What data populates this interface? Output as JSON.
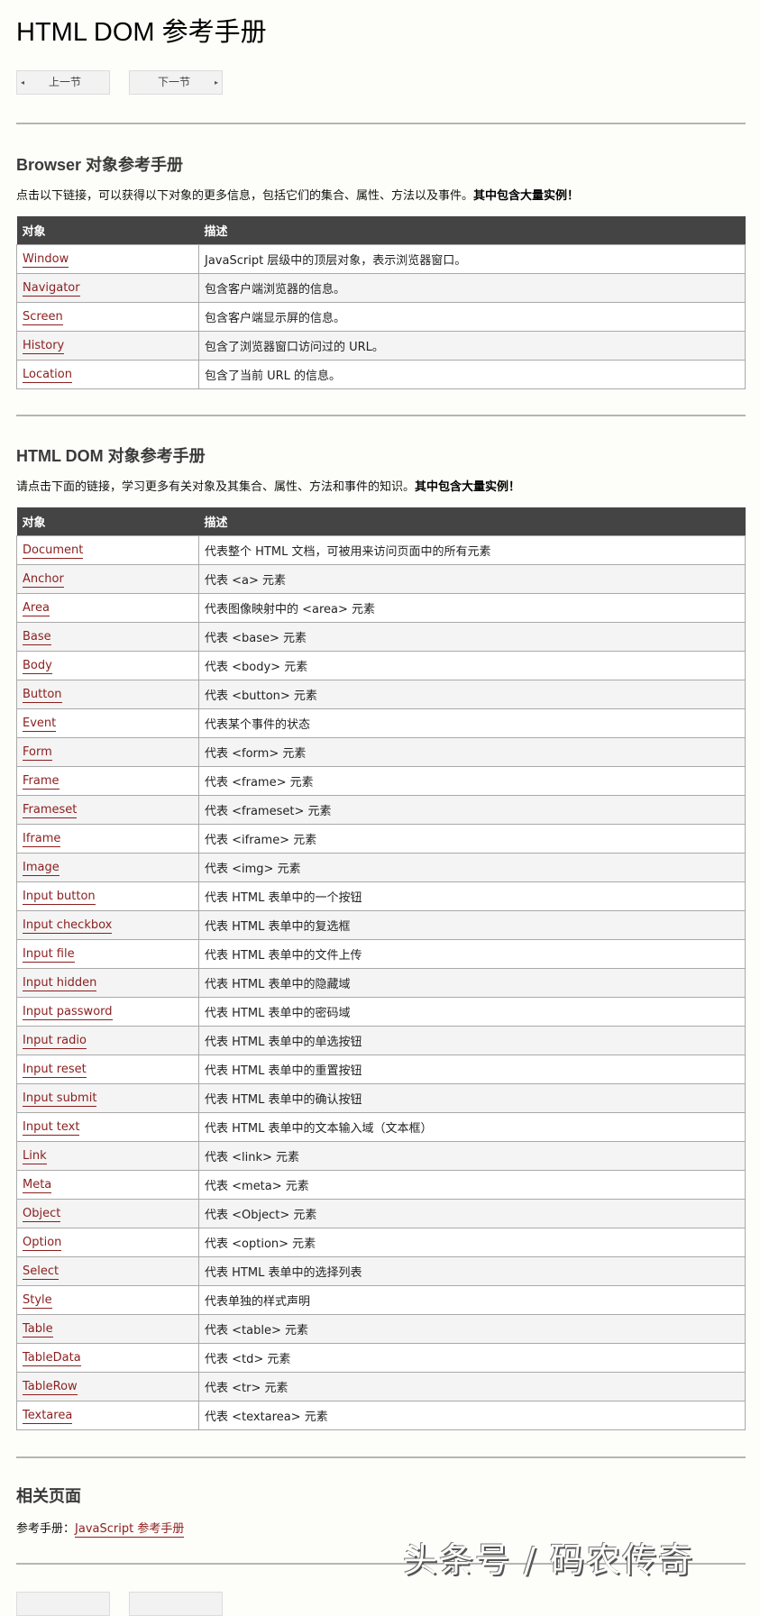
{
  "page_title": "HTML DOM 参考手册",
  "nav": {
    "prev_label": "上一节",
    "next_label": "下一节",
    "prev_icon": "◂",
    "next_icon": "▸"
  },
  "browser_section": {
    "heading": "Browser 对象参考手册",
    "intro": "点击以下链接，可以获得以下对象的更多信息，包括它们的集合、属性、方法以及事件。",
    "intro_bold": "其中包含大量实例！",
    "columns": [
      "对象",
      "描述"
    ],
    "rows": [
      {
        "name": "Window",
        "desc": "JavaScript 层级中的顶层对象，表示浏览器窗口。"
      },
      {
        "name": "Navigator",
        "desc": "包含客户端浏览器的信息。"
      },
      {
        "name": "Screen",
        "desc": "包含客户端显示屏的信息。"
      },
      {
        "name": "History",
        "desc": "包含了浏览器窗口访问过的 URL。"
      },
      {
        "name": "Location",
        "desc": "包含了当前 URL 的信息。"
      }
    ]
  },
  "dom_section": {
    "heading": "HTML DOM 对象参考手册",
    "intro": "请点击下面的链接，学习更多有关对象及其集合、属性、方法和事件的知识。",
    "intro_bold": "其中包含大量实例！",
    "columns": [
      "对象",
      "描述"
    ],
    "rows": [
      {
        "name": "Document",
        "desc": "代表整个 HTML 文档，可被用来访问页面中的所有元素"
      },
      {
        "name": "Anchor",
        "desc": "代表 <a> 元素"
      },
      {
        "name": "Area",
        "desc": "代表图像映射中的 <area> 元素"
      },
      {
        "name": "Base",
        "desc": "代表 <base> 元素"
      },
      {
        "name": "Body",
        "desc": "代表 <body> 元素"
      },
      {
        "name": "Button",
        "desc": "代表 <button> 元素"
      },
      {
        "name": "Event",
        "desc": "代表某个事件的状态"
      },
      {
        "name": "Form",
        "desc": "代表 <form> 元素"
      },
      {
        "name": "Frame",
        "desc": "代表 <frame> 元素"
      },
      {
        "name": "Frameset",
        "desc": "代表 <frameset> 元素"
      },
      {
        "name": "Iframe",
        "desc": "代表 <iframe> 元素"
      },
      {
        "name": "Image",
        "desc": "代表 <img> 元素"
      },
      {
        "name": "Input button",
        "desc": "代表 HTML 表单中的一个按钮"
      },
      {
        "name": "Input checkbox",
        "desc": "代表 HTML 表单中的复选框"
      },
      {
        "name": "Input file",
        "desc": "代表 HTML 表单中的文件上传"
      },
      {
        "name": "Input hidden",
        "desc": "代表 HTML 表单中的隐藏域"
      },
      {
        "name": "Input password",
        "desc": "代表 HTML 表单中的密码域"
      },
      {
        "name": "Input radio",
        "desc": "代表 HTML 表单中的单选按钮"
      },
      {
        "name": "Input reset",
        "desc": "代表 HTML 表单中的重置按钮"
      },
      {
        "name": "Input submit",
        "desc": "代表 HTML 表单中的确认按钮"
      },
      {
        "name": "Input text",
        "desc": "代表 HTML 表单中的文本输入域（文本框）"
      },
      {
        "name": "Link",
        "desc": "代表 <link> 元素"
      },
      {
        "name": "Meta",
        "desc": "代表 <meta> 元素"
      },
      {
        "name": "Object",
        "desc": "代表 <Object> 元素"
      },
      {
        "name": "Option",
        "desc": "代表 <option> 元素"
      },
      {
        "name": "Select",
        "desc": "代表 HTML 表单中的选择列表"
      },
      {
        "name": "Style",
        "desc": "代表单独的样式声明"
      },
      {
        "name": "Table",
        "desc": "代表 <table> 元素"
      },
      {
        "name": "TableData",
        "desc": "代表 <td> 元素"
      },
      {
        "name": "TableRow",
        "desc": "代表 <tr> 元素"
      },
      {
        "name": "Textarea",
        "desc": "代表 <textarea> 元素"
      }
    ]
  },
  "related": {
    "heading": "相关页面",
    "prefix": "参考手册：",
    "link_label": "JavaScript 参考手册"
  },
  "watermark": "头条号 / 码农传奇",
  "colors": {
    "link": "#8b1e1e",
    "table_header_bg": "#444444",
    "page_bg": "#fdfdf9"
  }
}
